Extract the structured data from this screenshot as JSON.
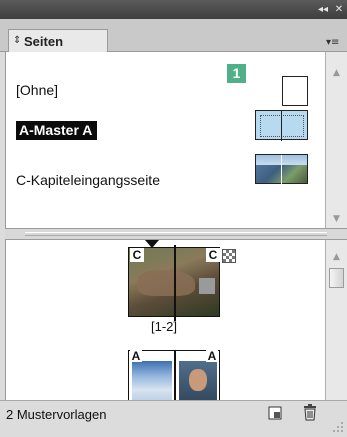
{
  "panel": {
    "tab_label": "Seiten",
    "tab_arrows": "⬍",
    "menu_icon": "panel-menu-icon",
    "collapse_glyph": "◂◂",
    "close_glyph": "▮"
  },
  "masters": {
    "items": [
      {
        "label": "[Ohne]",
        "selected": false
      },
      {
        "label": "A-Master A",
        "selected": true
      },
      {
        "label": "C-Kapiteleingangsseite",
        "selected": false
      }
    ],
    "badge": "1"
  },
  "pages": {
    "spreads": [
      {
        "label": "[1-2]",
        "left_master": "C",
        "right_master": "C"
      },
      {
        "label": "",
        "left_master": "A",
        "right_master": "A"
      }
    ]
  },
  "footer": {
    "status": "2 Mustervorlagen"
  },
  "colors": {
    "badge_green": "#4fb08a",
    "selected_bg": "#0b0b0b",
    "master_a_fill": "#b8daf0"
  }
}
